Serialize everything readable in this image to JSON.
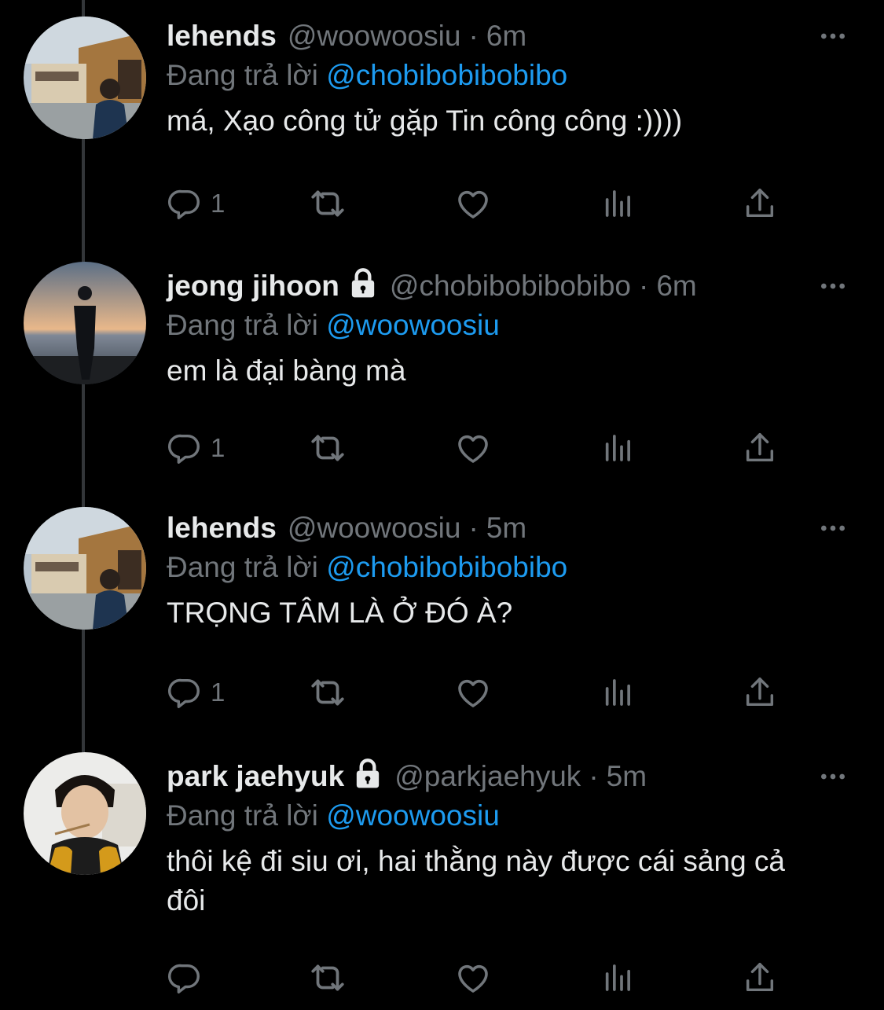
{
  "ui": {
    "accent": "#1d9bf0",
    "muted": "#71767b",
    "text": "#e7e9ea",
    "background": "#000000"
  },
  "tweets": [
    {
      "name": "lehends",
      "handle": "@woowoosiu",
      "separator": "·",
      "time": "6m",
      "protected": false,
      "reply_prefix": "Đang trả lời",
      "reply_to": "@chobibobibobibo",
      "text": "má, Xạo công tử gặp Tin công công :))))",
      "reply_count": "1",
      "icons": [
        "reply-icon",
        "retweet-icon",
        "like-icon",
        "analytics-icon",
        "share-icon"
      ]
    },
    {
      "name": "jeong jihoon",
      "handle": "@chobibobibobibo",
      "separator": "·",
      "time": "6m",
      "protected": true,
      "reply_prefix": "Đang trả lời",
      "reply_to": "@woowoosiu",
      "text": "em là đại bàng mà",
      "reply_count": "1",
      "icons": [
        "reply-icon",
        "retweet-icon",
        "like-icon",
        "analytics-icon",
        "share-icon"
      ]
    },
    {
      "name": "lehends",
      "handle": "@woowoosiu",
      "separator": "·",
      "time": "5m",
      "protected": false,
      "reply_prefix": "Đang trả lời",
      "reply_to": "@chobibobibobibo",
      "text": "TRỌNG TÂM LÀ Ở ĐÓ À?",
      "reply_count": "1",
      "icons": [
        "reply-icon",
        "retweet-icon",
        "like-icon",
        "analytics-icon",
        "share-icon"
      ]
    },
    {
      "name": "park jaehyuk",
      "handle": "@parkjaehyuk",
      "separator": "·",
      "time": "5m",
      "protected": true,
      "reply_prefix": "Đang trả lời",
      "reply_to": "@woowoosiu",
      "text": "thôi kệ đi siu ơi, hai thằng này được cái sảng cả đôi",
      "reply_count": "",
      "icons": [
        "reply-icon",
        "retweet-icon",
        "like-icon",
        "analytics-icon",
        "share-icon"
      ]
    }
  ]
}
